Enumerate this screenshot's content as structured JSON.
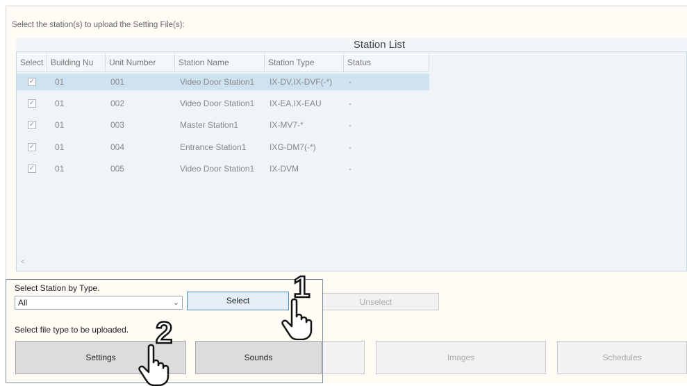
{
  "instruction": "Select the station(s) to upload the Setting File(s):",
  "station_list": {
    "title": "Station List",
    "columns": [
      "Select",
      "Building Nu",
      "Unit Number",
      "Station Name",
      "Station Type",
      "Status"
    ],
    "rows": [
      {
        "building": "01",
        "unit": "001",
        "name": "Video Door Station1",
        "type": "IX-DV,IX-DVF(-*)",
        "status": "-"
      },
      {
        "building": "01",
        "unit": "002",
        "name": "Video Door Station1",
        "type": "IX-EA,IX-EAU",
        "status": "-"
      },
      {
        "building": "01",
        "unit": "003",
        "name": "Master Station1",
        "type": "IX-MV7-*",
        "status": "-"
      },
      {
        "building": "01",
        "unit": "004",
        "name": "Entrance Station1",
        "type": "IXG-DM7(-*)",
        "status": "-"
      },
      {
        "building": "01",
        "unit": "005",
        "name": "Video Door Station1",
        "type": "IX-DVM",
        "status": "-"
      }
    ],
    "scroll_left": "<"
  },
  "select_by_type": {
    "label": "Select Station by Type.",
    "value": "All",
    "select_button": "Select",
    "unselect_button": "Unselect"
  },
  "file_type": {
    "label": "Select file type to be uploaded.",
    "buttons": [
      "Settings",
      "Sounds",
      "Images",
      "Schedules"
    ]
  },
  "callouts": [
    "1",
    "2"
  ]
}
